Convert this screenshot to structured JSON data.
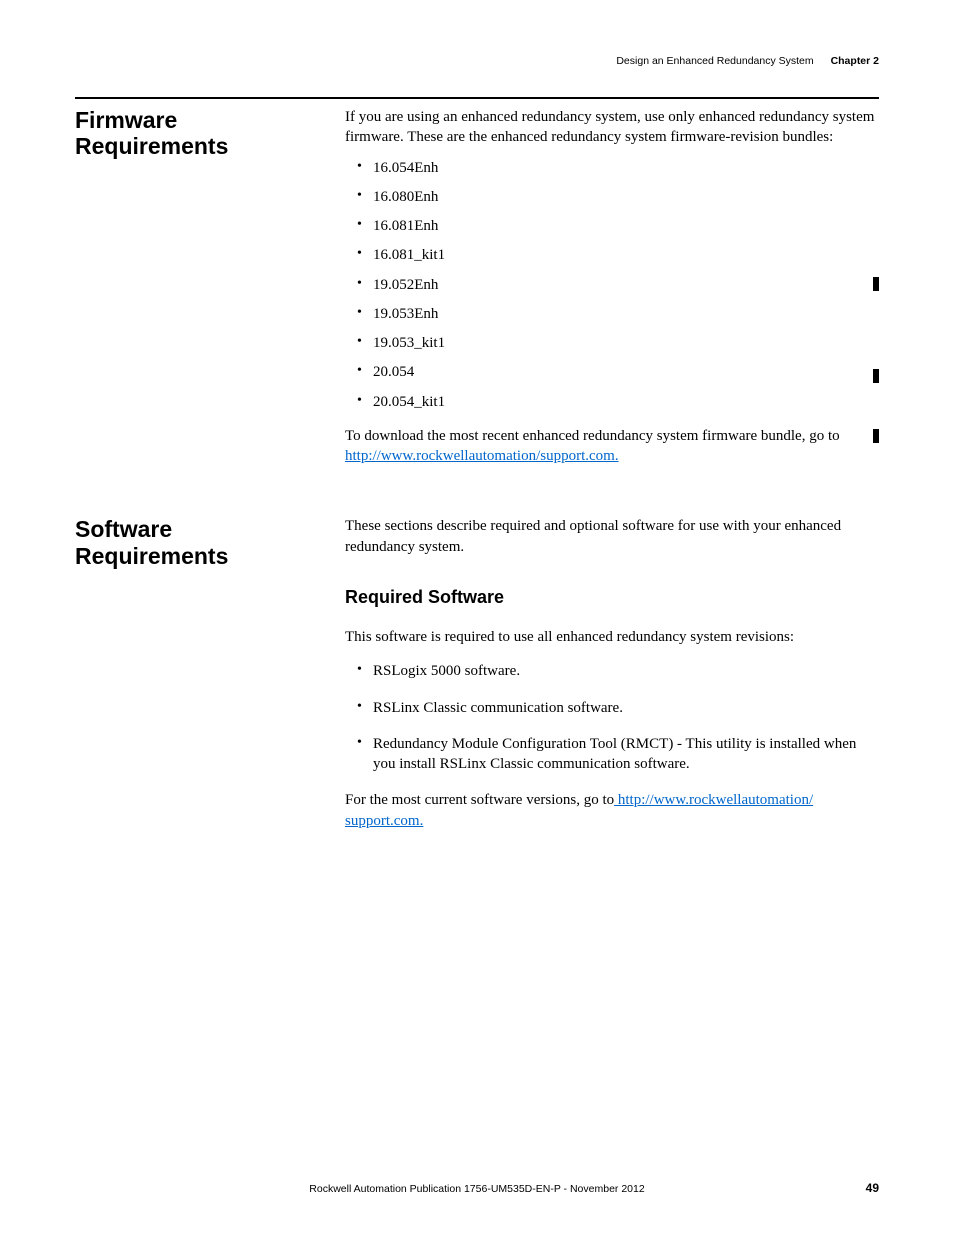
{
  "header": {
    "running_title": "Design an Enhanced Redundancy System",
    "chapter": "Chapter 2"
  },
  "firmware": {
    "heading": "Firmware Requirements",
    "intro": "If you are using an enhanced redundancy system, use only enhanced redundancy system firmware. These are the enhanced redundancy system firmware-revision bundles:",
    "bundles": [
      "16.054Enh",
      "16.080Enh",
      "16.081Enh",
      "16.081_kit1",
      "19.052Enh",
      "19.053Enh",
      "19.053_kit1",
      "20.054",
      "20.054_kit1"
    ],
    "download_prefix": "To download the most recent enhanced redundancy system firmware bundle, go to",
    "download_link": " http://www.rockwellautomation/support.com."
  },
  "software": {
    "heading": "Software Requirements",
    "intro": "These sections describe required and optional software for use with your enhanced redundancy system.",
    "required_heading": "Required Software",
    "required_intro": "This software is required to use all enhanced redundancy system revisions:",
    "required_items": [
      "RSLogix 5000 software.",
      "RSLinx Classic communication software.",
      "Redundancy Module Configuration Tool (RMCT) - This utility is installed when you install RSLinx Classic communication software."
    ],
    "versions_prefix": "For the most current software versions, go to",
    "versions_link_1": " http://www.rockwellautomation/",
    "versions_link_2": "support.com."
  },
  "footer": {
    "publication": "Rockwell Automation Publication 1756-UM535D-EN-P - November 2012",
    "page": "49"
  }
}
